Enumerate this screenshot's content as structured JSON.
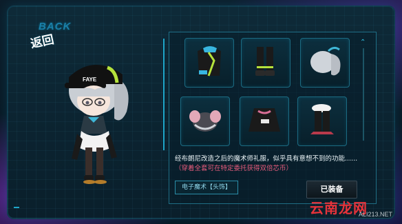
{
  "back": {
    "en": "BACK",
    "cn": "返回"
  },
  "character": {
    "cap_text": "FAYE"
  },
  "items": [
    {
      "icon": "jacket-icon"
    },
    {
      "icon": "boots-icon"
    },
    {
      "icon": "hair-ponytail-icon"
    },
    {
      "icon": "hair-buns-icon"
    },
    {
      "icon": "cape-icon"
    },
    {
      "icon": "leg-boots-icon"
    }
  ],
  "description": {
    "main": "经布朗尼改造之后的魔术师礼服，似乎具有意想不到的功能......",
    "note": "（穿着全套可在特定委托获得双倍芯币）"
  },
  "item_tag": "电子魔术【头饰】",
  "equip_button": "已装备",
  "watermark": {
    "cn": "云南龙网",
    "en": "ALI213.NET"
  },
  "colors": {
    "accent": "#1ea6c9",
    "note": "#e85c7c",
    "watermark": "#e8333a"
  }
}
